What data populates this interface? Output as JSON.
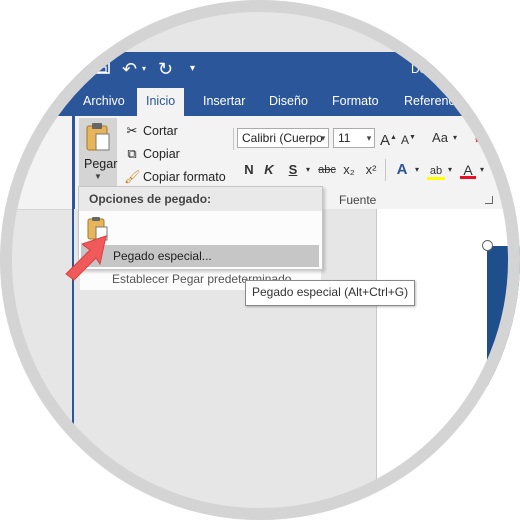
{
  "window": {
    "doc_title": "Do"
  },
  "tabs": [
    {
      "label": "Archivo"
    },
    {
      "label": "Inicio"
    },
    {
      "label": "Insertar"
    },
    {
      "label": "Diseño"
    },
    {
      "label": "Formato"
    },
    {
      "label": "Referencia"
    }
  ],
  "clipboard": {
    "paste_label": "Pegar",
    "cut_label": "Cortar",
    "copy_label": "Copiar",
    "format_painter_label": "Copiar formato"
  },
  "font": {
    "font_name": "Calibri (Cuerpo",
    "font_size": "11",
    "group_label": "Fuente",
    "case_label": "Aa",
    "bold": "N",
    "italic": "K",
    "underline": "S",
    "strike": "abc",
    "sub": "x₂",
    "sup": "x²"
  },
  "paste_menu": {
    "header": "Opciones de pegado:",
    "item_special": "Pegado especial...",
    "item_default": "Establecer Pegar predeterminado..."
  },
  "tooltip": {
    "text": "Pegado especial (Alt+Ctrl+G)"
  },
  "colors": {
    "brand_blue": "#2b579a",
    "highlight_yellow": "#ffff00",
    "font_red": "#e81123",
    "pointer_red": "#f05a5a"
  }
}
